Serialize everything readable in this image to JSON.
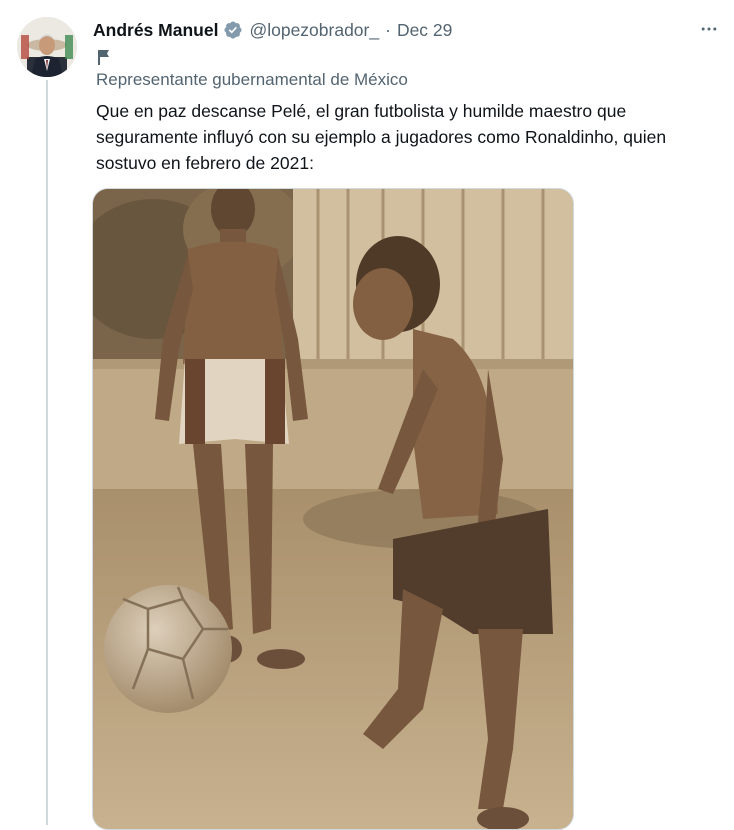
{
  "tweet": {
    "author_name": "Andrés Manuel",
    "handle": "@lopezobrador_",
    "separator": "·",
    "date": "Dec 29",
    "affiliation": "Representante gubernamental de México",
    "text": "Que en paz descanse Pelé, el gran futbolista y humilde maestro que seguramente influyó con su ejemplo a jugadores como Ronaldinho, quien sostuvo en febrero de 2021:",
    "icons": {
      "avatar": "avatar-photo",
      "verified": "verified-badge-icon",
      "affiliation": "flag-icon",
      "more": "more-options-icon"
    },
    "colors": {
      "verified": "#829aab",
      "secondary_text": "#536471",
      "thread_line": "#cfd9de",
      "photo_sepia": "#b8a27f"
    }
  }
}
